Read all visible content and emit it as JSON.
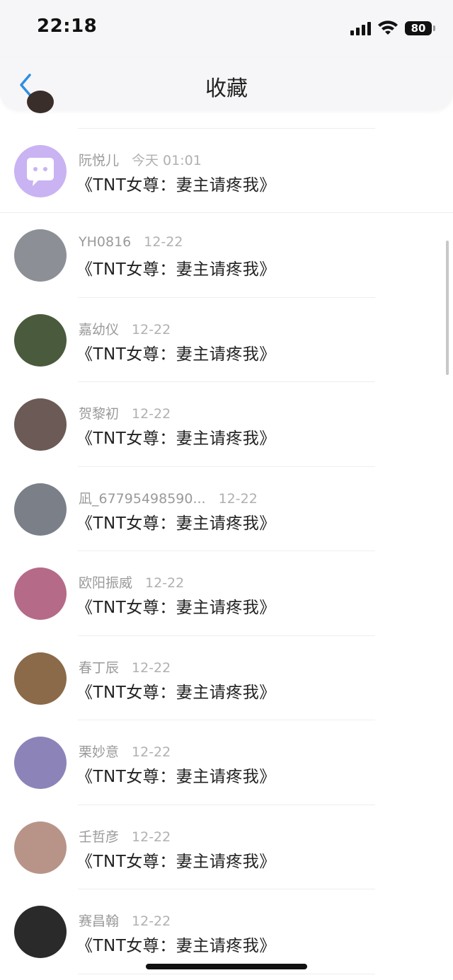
{
  "status_bar": {
    "time": "22:18",
    "battery": "80"
  },
  "nav": {
    "title": "收藏"
  },
  "items": [
    {
      "name": "阮悦儿",
      "date": "今天 01:01",
      "content": "《TNT女尊：妻主请疼我》",
      "avatar_color": "#c9b3f2"
    },
    {
      "name": "YH0816",
      "date": "12-22",
      "content": "《TNT女尊：妻主请疼我》",
      "avatar_color": "#8c8f96"
    },
    {
      "name": "嘉幼仪",
      "date": "12-22",
      "content": "《TNT女尊：妻主请疼我》",
      "avatar_color": "#4a5a3c"
    },
    {
      "name": "贺黎初",
      "date": "12-22",
      "content": "《TNT女尊：妻主请疼我》",
      "avatar_color": "#6b5a55"
    },
    {
      "name": "凪_67795498590...",
      "date": "12-22",
      "content": "《TNT女尊：妻主请疼我》",
      "avatar_color": "#7a7f88"
    },
    {
      "name": "欧阳振威",
      "date": "12-22",
      "content": "《TNT女尊：妻主请疼我》",
      "avatar_color": "#b56a88"
    },
    {
      "name": "春丁辰",
      "date": "12-22",
      "content": "《TNT女尊：妻主请疼我》",
      "avatar_color": "#8a6a48"
    },
    {
      "name": "栗妙意",
      "date": "12-22",
      "content": "《TNT女尊：妻主请疼我》",
      "avatar_color": "#8c84b8"
    },
    {
      "name": "壬哲彦",
      "date": "12-22",
      "content": "《TNT女尊：妻主请疼我》",
      "avatar_color": "#b89488"
    },
    {
      "name": "赛昌翰",
      "date": "12-22",
      "content": "《TNT女尊：妻主请疼我》",
      "avatar_color": "#2a2a2a"
    }
  ]
}
